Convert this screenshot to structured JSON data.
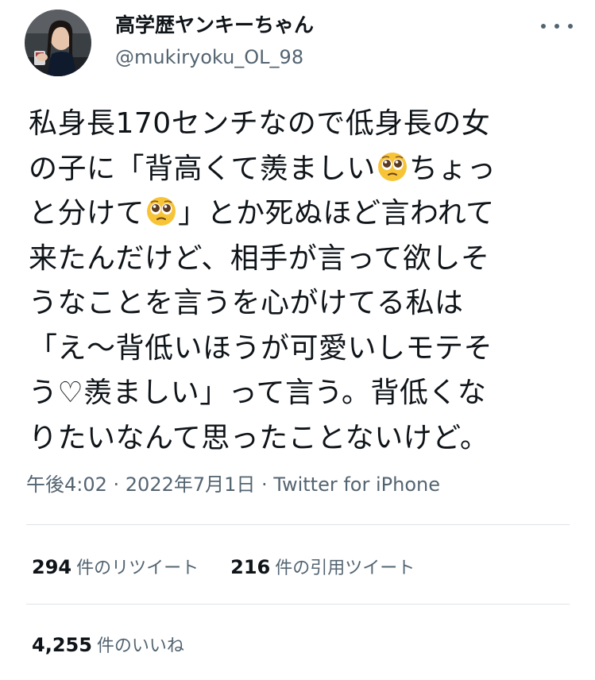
{
  "user": {
    "display_name": "高学歴ヤンキーちゃん",
    "handle": "@mukiryoku_OL_98"
  },
  "tweet": {
    "lines": [
      [
        "私身長170センチなので低身長の女"
      ],
      [
        "の子に「背高くて羨ましい",
        "ちょっ"
      ],
      [
        "と分けて",
        "」とか死ぬほど言われて"
      ],
      [
        "来たんだけど、相手が言って欲しそ"
      ],
      [
        "うなことを言うを心がけてる私は"
      ],
      [
        "「え〜背低いほうが可愛いしモテそ"
      ],
      [
        "う♡羨ましい」って言う。背低くな"
      ],
      [
        "りたいなんて思ったことないけど。"
      ]
    ],
    "emoji_icon": "pleading-face-emoji",
    "timestamp": "午後4:02 · 2022年7月1日 · Twitter for iPhone"
  },
  "stats": {
    "retweets": {
      "count": "294",
      "label": "件のリツイート"
    },
    "quotes": {
      "count": "216",
      "label": "件の引用ツイート"
    },
    "likes": {
      "count": "4,255",
      "label": "件のいいね"
    }
  },
  "colors": {
    "text": "#0f1419",
    "secondary": "#536471",
    "divider": "#dfe3e7",
    "emoji": "#f7c438"
  }
}
